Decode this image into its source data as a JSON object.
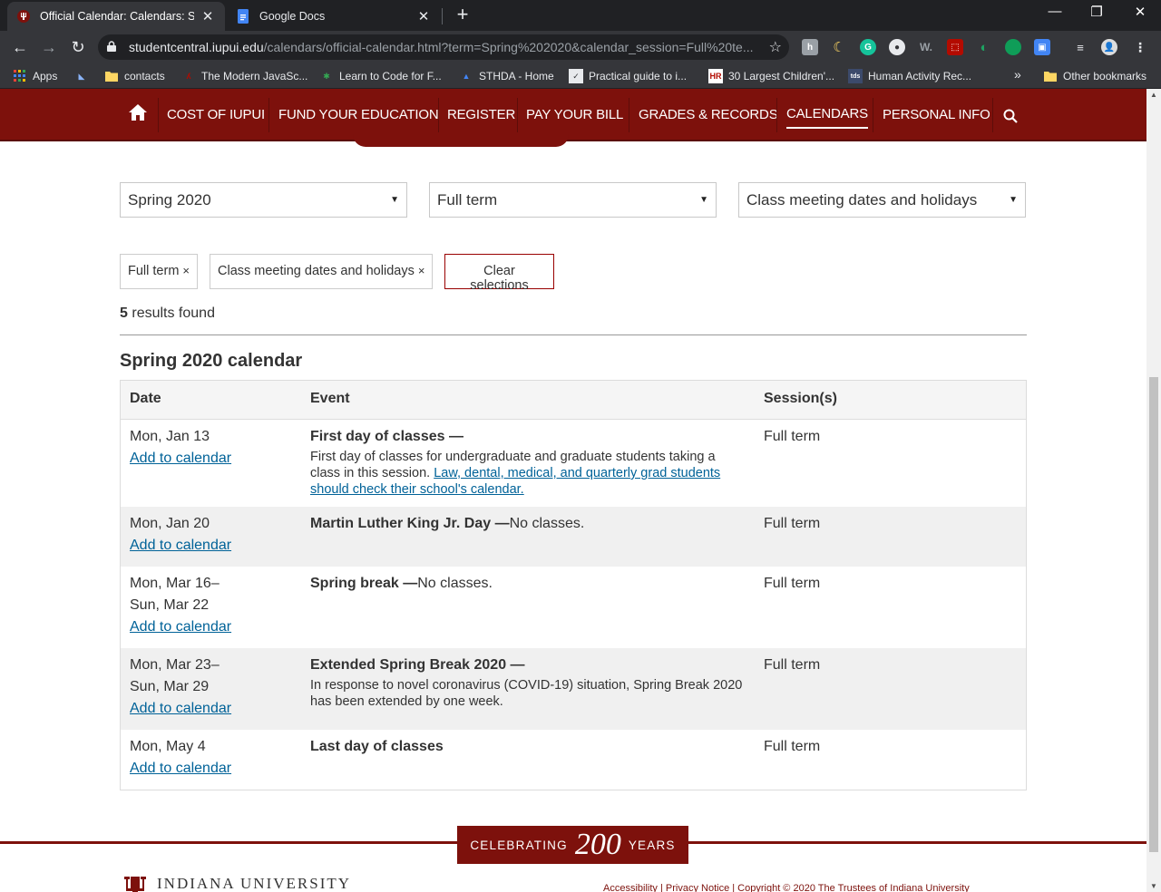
{
  "browser": {
    "tabs": [
      {
        "title": "Official Calendar: Calendars: Stud",
        "active": true
      },
      {
        "title": "Google Docs",
        "active": false
      }
    ],
    "url_host": "studentcentral.iupui.edu",
    "url_path": "/calendars/official-calendar.html?term=Spring%202020&calendar_session=Full%20te...",
    "bookmarks": [
      {
        "label": "Apps"
      },
      {
        "label": "contacts"
      },
      {
        "label": "The Modern JavaSc..."
      },
      {
        "label": "Learn to Code for F..."
      },
      {
        "label": "STHDA - Home"
      },
      {
        "label": "Practical guide to i..."
      },
      {
        "label": "30 Largest Children'..."
      },
      {
        "label": "Human Activity Rec..."
      },
      {
        "label": "Other bookmarks"
      }
    ],
    "overflow": "»"
  },
  "nav": {
    "items": [
      "COST OF IUPUI",
      "FUND YOUR EDUCATION",
      "REGISTER",
      "PAY YOUR BILL",
      "GRADES & RECORDS",
      "CALENDARS",
      "PERSONAL INFO"
    ],
    "current": "CALENDARS"
  },
  "filters": {
    "term": "Spring 2020",
    "session": "Full term",
    "type": "Class meeting dates and holidays"
  },
  "chips": {
    "session": "Full term",
    "type": "Class meeting dates and holidays",
    "remove": "×",
    "clear": "Clear selections"
  },
  "results": {
    "count": "5",
    "suffix": "results found"
  },
  "calendar": {
    "title": "Spring 2020 calendar",
    "headers": {
      "date": "Date",
      "event": "Event",
      "sessions": "Session(s)"
    },
    "add_label": "Add to calendar",
    "rows": [
      {
        "date1": "Mon, Jan 13",
        "date2": "",
        "title": "First day of classes —",
        "inline": "",
        "desc": "First day of classes for undergraduate and graduate students taking a class in this session. ",
        "link": "Law, dental, medical, and quarterly grad students should check their school's calendar.",
        "session": "Full term"
      },
      {
        "date1": "Mon, Jan 20",
        "date2": "",
        "title": "Martin Luther King Jr. Day —",
        "inline": "No classes.",
        "desc": "",
        "link": "",
        "session": "Full term"
      },
      {
        "date1": "Mon, Mar 16–",
        "date2": "Sun, Mar 22",
        "title": "Spring break —",
        "inline": "No classes.",
        "desc": "",
        "link": "",
        "session": "Full term"
      },
      {
        "date1": "Mon, Mar 23–",
        "date2": "Sun, Mar 29",
        "title": "Extended Spring Break 2020 —",
        "inline": "",
        "desc": "In response to novel coronavirus (COVID-19) situation, Spring Break 2020 has been extended by one week.",
        "link": "",
        "session": "Full term"
      },
      {
        "date1": "Mon, May 4",
        "date2": "",
        "title": "Last day of classes",
        "inline": "",
        "desc": "",
        "link": "",
        "session": "Full term"
      }
    ]
  },
  "footer": {
    "badge_pre": "CELEBRATING",
    "badge_num": "200",
    "badge_post": "YEARS",
    "university": "INDIANA UNIVERSITY",
    "accessibility": "Accessibility",
    "privacy": "Privacy Notice",
    "copyright_pre": "Copyright © 2020 The Trustees of ",
    "copyright_link": "Indiana University"
  },
  "colors": {
    "brand": "#7d110c",
    "link": "#006298"
  }
}
